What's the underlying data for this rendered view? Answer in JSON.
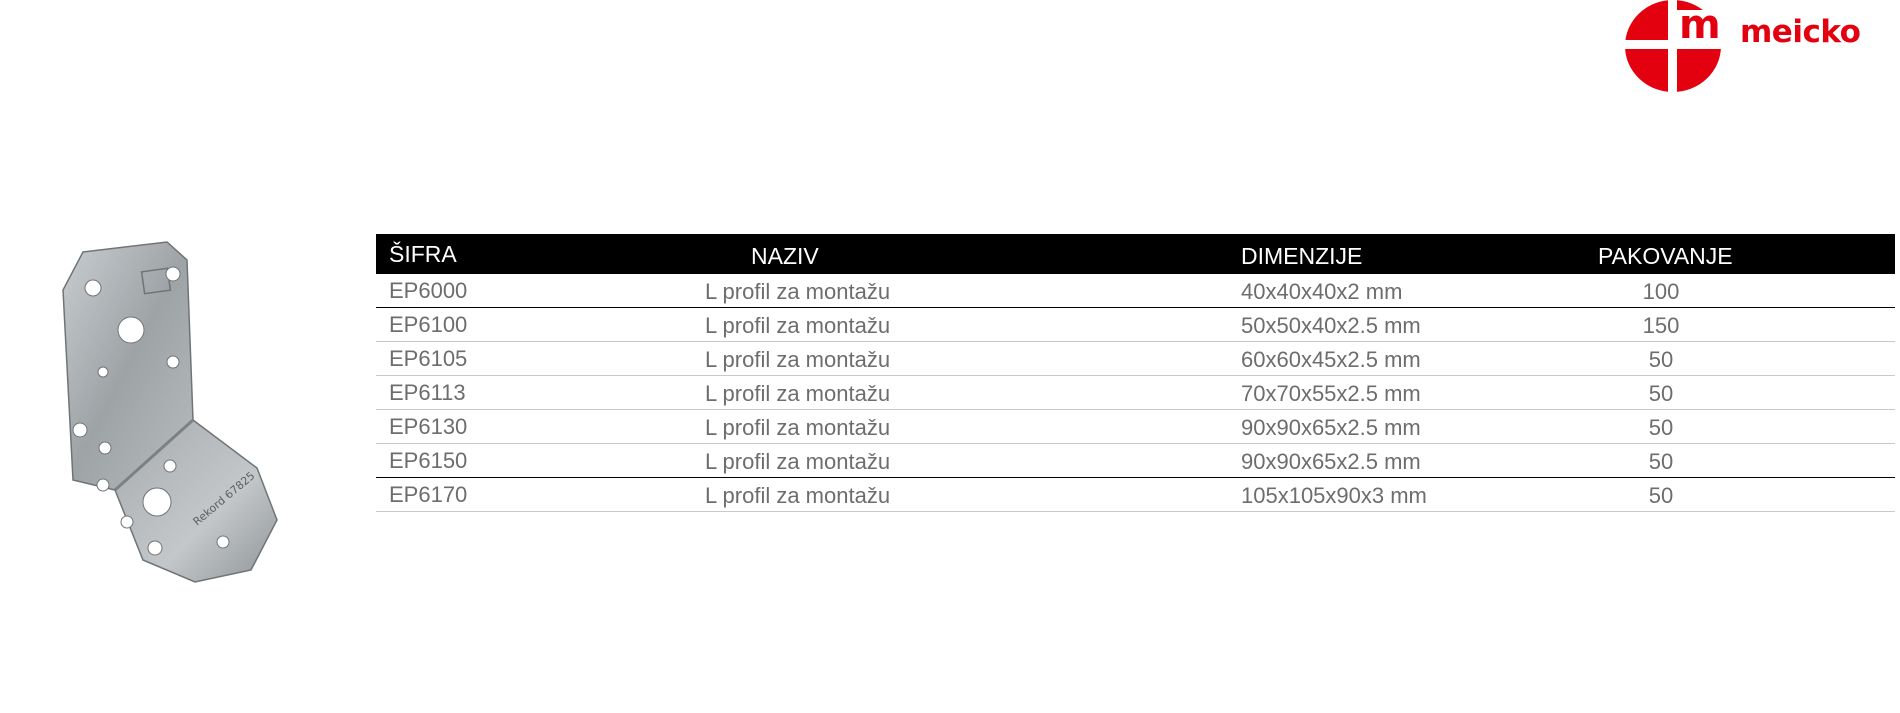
{
  "brand": {
    "name": "meicko",
    "logo_letter": "m",
    "primary_color": "#e3000f"
  },
  "product_image": {
    "alt": "L profil za montažu",
    "markings": "Rekord 67825"
  },
  "table": {
    "headers": {
      "code": "ŠIFRA",
      "name": "NAZIV",
      "dimensions": "DIMENZIJE",
      "packaging": "PAKOVANJE"
    },
    "rows": [
      {
        "code": "EP6000",
        "name": "L profil za montažu",
        "dimensions": "40x40x40x2   mm",
        "packaging": "100"
      },
      {
        "code": "EP6100",
        "name": "L profil za montažu",
        "dimensions": "50x50x40x2.5 mm",
        "packaging": "150"
      },
      {
        "code": "EP6105",
        "name": "L profil za montažu",
        "dimensions": "60x60x45x2.5 mm",
        "packaging": "50"
      },
      {
        "code": "EP6113",
        "name": "L profil za montažu",
        "dimensions": "70x70x55x2.5 mm",
        "packaging": "50"
      },
      {
        "code": "EP6130",
        "name": "L profil za montažu",
        "dimensions": "90x90x65x2.5 mm",
        "packaging": "50"
      },
      {
        "code": "EP6150",
        "name": "L profil za montažu",
        "dimensions": "90x90x65x2.5 mm",
        "packaging": "50"
      },
      {
        "code": "EP6170",
        "name": "L profil za montažu",
        "dimensions": "105x105x90x3 mm",
        "packaging": "50"
      }
    ]
  }
}
